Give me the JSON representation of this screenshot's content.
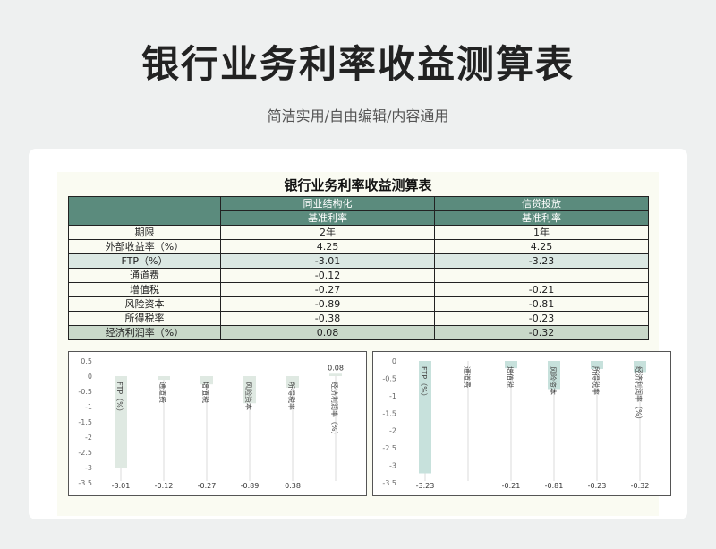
{
  "header": {
    "title": "银行业务利率收益测算表",
    "subtitle": "简洁实用/自由编辑/内容通用"
  },
  "sheet": {
    "title": "银行业务利率收益测算表",
    "columns": [
      {
        "group": "同业结构化",
        "sub": "基准利率"
      },
      {
        "group": "信贷投放",
        "sub": "基准利率"
      }
    ],
    "rows": [
      {
        "label": "期限",
        "a": "2年",
        "b": "1年",
        "style": "plain"
      },
      {
        "label": "外部收益率（%）",
        "a": "4.25",
        "b": "4.25",
        "style": "plain"
      },
      {
        "label": "FTP（%）",
        "a": "-3.01",
        "b": "-3.23",
        "style": "hl"
      },
      {
        "label": "通道费",
        "a": "-0.12",
        "b": "",
        "style": "plain"
      },
      {
        "label": "增值税",
        "a": "-0.27",
        "b": "-0.21",
        "style": "plain"
      },
      {
        "label": "风险资本",
        "a": "-0.89",
        "b": "-0.81",
        "style": "plain"
      },
      {
        "label": "所得税率",
        "a": "-0.38",
        "b": "-0.23",
        "style": "plain"
      },
      {
        "label": "经济利润率（%）",
        "a": "0.08",
        "b": "-0.32",
        "style": "hl2"
      }
    ]
  },
  "colors": {
    "bar_left": "#dfe9e2",
    "bar_right": "#c7e1dc",
    "header_bg": "#5b8b7d"
  },
  "chart_data": [
    {
      "type": "bar",
      "categories": [
        "FTP（%）",
        "通道费",
        "增值税",
        "风险资本",
        "所得税率",
        "经济利润率（%）"
      ],
      "values": [
        -3.01,
        -0.12,
        -0.27,
        -0.89,
        -0.38,
        0.08
      ],
      "data_labels": [
        "-3.01",
        "-0.12",
        "-0.27",
        "-0.89",
        "0.38",
        "0.08"
      ],
      "ylim": [
        -3.5,
        0.5
      ],
      "yticks": [
        "0.5",
        "0",
        "-0.5",
        "-1",
        "-1.5",
        "-2",
        "-2.5",
        "-3",
        "-3.5"
      ],
      "grid": false
    },
    {
      "type": "bar",
      "categories": [
        "FTP（%）",
        "通道费",
        "增值税",
        "风险资本",
        "所得税率",
        "经济利润率（%）"
      ],
      "values": [
        -3.23,
        0,
        -0.21,
        -0.81,
        -0.23,
        -0.32
      ],
      "data_labels": [
        "-3.23",
        "",
        "-0.21",
        "-0.81",
        "-0.23",
        "-0.32"
      ],
      "ylim": [
        -3.5,
        0
      ],
      "yticks": [
        "0",
        "-0.5",
        "-1",
        "-1.5",
        "-2",
        "-2.5",
        "-3",
        "-3.5"
      ],
      "grid": false
    }
  ]
}
